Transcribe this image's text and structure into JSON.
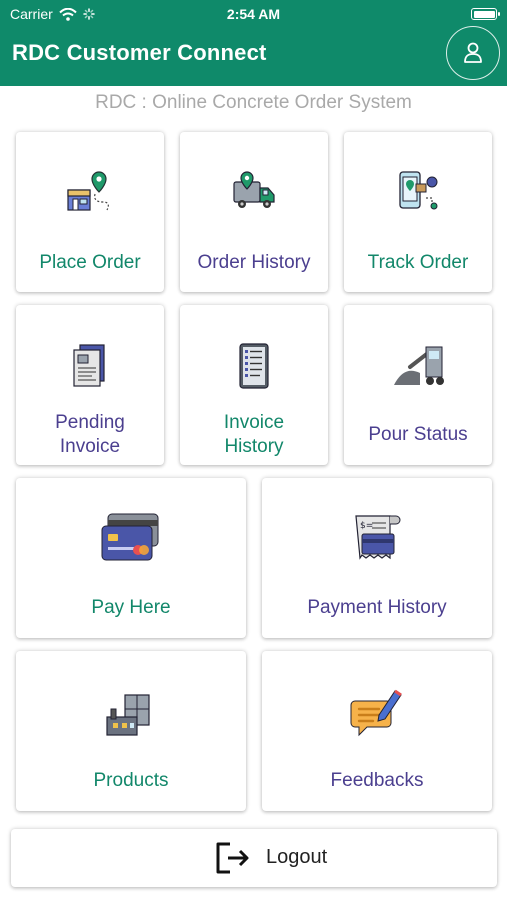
{
  "status_bar": {
    "carrier": "Carrier",
    "time": "2:54 AM"
  },
  "header": {
    "title": "RDC Customer Connect",
    "profile_icon": "user-icon"
  },
  "subtitle": "RDC : Online Concrete Order System",
  "colors": {
    "header_bg": "#0f8a6a",
    "teal_label": "#12876a",
    "purple_label": "#4b3f8f"
  },
  "tiles": {
    "place_order": {
      "label": "Place Order",
      "icon": "map-route-icon"
    },
    "order_history": {
      "label": "Order History",
      "icon": "delivery-truck-icon"
    },
    "track_order": {
      "label": "Track Order",
      "icon": "phone-tracking-icon"
    },
    "pending_invoice": {
      "label_line1": "Pending",
      "label_line2": "Invoice",
      "icon": "invoice-document-icon"
    },
    "invoice_history": {
      "label_line1": "Invoice",
      "label_line2": "History",
      "icon": "invoice-list-icon"
    },
    "pour_status": {
      "label": "Pour Status",
      "icon": "concrete-pour-icon"
    },
    "pay_here": {
      "label": "Pay Here",
      "icon": "credit-card-icon"
    },
    "payment_history": {
      "label": "Payment History",
      "icon": "receipt-card-icon"
    },
    "products": {
      "label": "Products",
      "icon": "factory-icon"
    },
    "feedbacks": {
      "label": "Feedbacks",
      "icon": "feedback-pen-icon"
    }
  },
  "logout": {
    "label": "Logout",
    "icon": "logout-icon"
  }
}
